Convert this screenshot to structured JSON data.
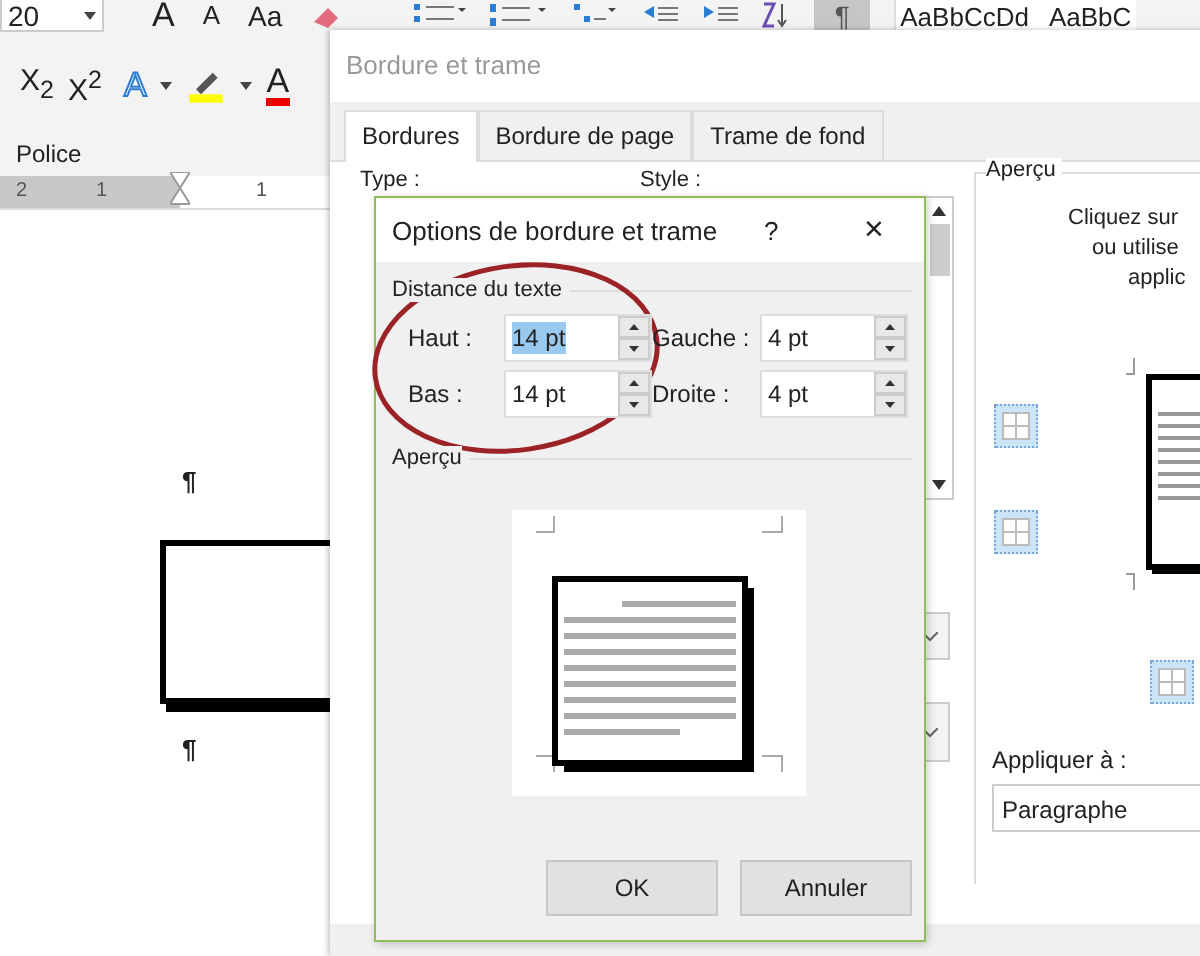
{
  "ribbon": {
    "font_size": "20",
    "grow_font": "A",
    "shrink_font": "A",
    "change_case": "Aa",
    "subscript": "X$_{2}$",
    "superscript": "X$^{2}$",
    "text_effects": "A",
    "font_color": "A",
    "group_label": "Police",
    "show_marks": {
      "label": "¶",
      "selected": true
    },
    "styles": [
      "AaBbCcDd",
      "AaBbC"
    ]
  },
  "ruler": {
    "numbers": [
      "2",
      "1",
      "1"
    ]
  },
  "document": {
    "marks": [
      "¶",
      "¶"
    ]
  },
  "dialog": {
    "title": "Bordure et trame",
    "tabs": [
      {
        "label": "Bordures",
        "selected": true
      },
      {
        "label": "Bordure de page",
        "selected": false
      },
      {
        "label": "Trame de fond",
        "selected": false
      }
    ],
    "type_label": "Type :",
    "style_label": "Style :",
    "preview": {
      "label": "Aperçu",
      "instructions": [
        "Cliquez sur",
        "ou utilise",
        "applic"
      ],
      "apply_label": "Appliquer à :",
      "apply_value": "Paragraphe"
    }
  },
  "options_dialog": {
    "title": "Options de bordure et trame",
    "help": "?",
    "close": "×",
    "section": "Distance du texte",
    "fields": [
      {
        "label": "Haut :",
        "value": "14 pt",
        "selected": true
      },
      {
        "label": "Gauche :",
        "value": "4 pt",
        "selected": false
      },
      {
        "label": "Bas :",
        "value": "14 pt",
        "selected": false
      },
      {
        "label": "Droite :",
        "value": "4 pt",
        "selected": false
      }
    ],
    "preview_label": "Aperçu",
    "buttons": [
      "OK",
      "Annuler"
    ]
  }
}
